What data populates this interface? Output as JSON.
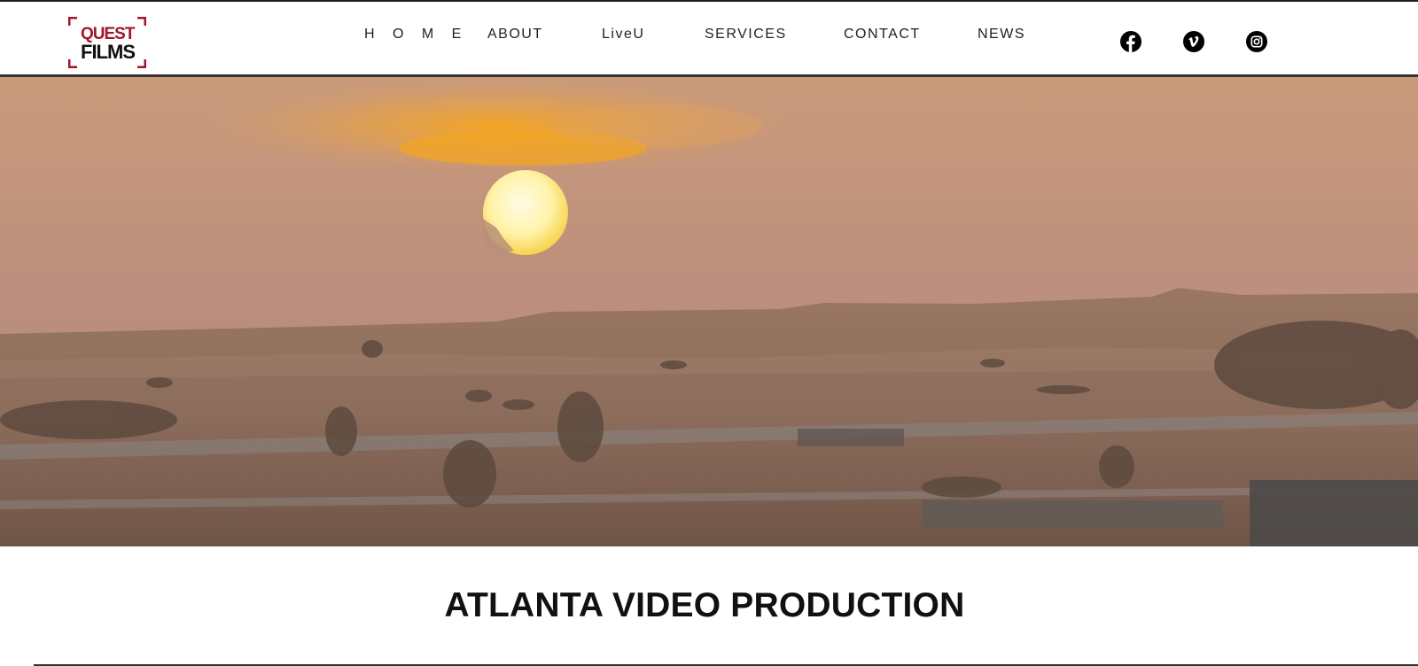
{
  "logo": {
    "line1": "QUEST",
    "line2": "FILMS",
    "brand_color": "#a0172a"
  },
  "nav": {
    "items": [
      {
        "label": "H O M E"
      },
      {
        "label": "ABOUT"
      },
      {
        "label": "LiveU"
      },
      {
        "label": "SERVICES"
      },
      {
        "label": "CONTACT"
      },
      {
        "label": "NEWS"
      }
    ]
  },
  "social": [
    {
      "icon": "facebook-icon"
    },
    {
      "icon": "vimeo-icon"
    },
    {
      "icon": "instagram-icon"
    }
  ],
  "hero": {
    "icon": "desert-sunset-image"
  },
  "main": {
    "title": "ATLANTA VIDEO PRODUCTION"
  }
}
